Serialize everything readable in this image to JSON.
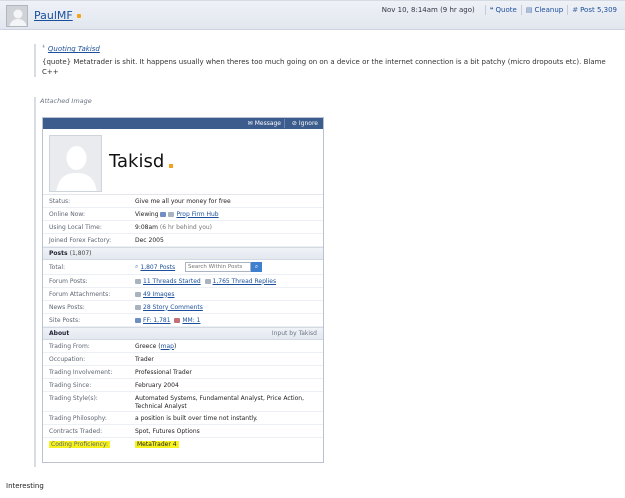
{
  "post": {
    "username": "PaulMF",
    "timestamp": "Nov 10, 8:14am (9 hr ago)",
    "actions": [
      {
        "label": "Quote",
        "icon": "quote-icon"
      },
      {
        "label": "Cleanup",
        "icon": "cleanup-icon"
      },
      {
        "label": "Post 5,309",
        "icon": "hash-icon"
      }
    ],
    "quote": {
      "author": "Quoting Takisd",
      "text": "{quote} Metatrader is shit. It happens usually when theres too much going on on a device or the internet connection is a bit patchy (micro dropouts etc). Blame C++"
    },
    "attached_label": "Attached Image",
    "reply": "Interesting"
  },
  "profile": {
    "buttons": {
      "message": "Message",
      "ignore": "Ignore"
    },
    "name": "Takisd",
    "info": [
      {
        "label": "Status:",
        "value": "Give me all your money for free"
      },
      {
        "label": "Online Now:",
        "value_prefix": "Viewing",
        "value_link": "Prop Firm Hub"
      },
      {
        "label": "Using Local Time:",
        "value": "9:08am",
        "value_muted": "(6 hr behind you)"
      },
      {
        "label": "Joined Forex Factory:",
        "value": "Dec 2005"
      }
    ],
    "posts_section": {
      "title": "Posts",
      "count": "(1,807)"
    },
    "posts": {
      "total_label": "Total:",
      "total_value": "1,807 Posts",
      "search_placeholder": "Search Within Posts",
      "forum_posts_label": "Forum Posts:",
      "threads_started": "11 Threads Started",
      "thread_replies": "1,765 Thread Replies",
      "attachments_label": "Forum Attachments:",
      "attachments_value": "49 Images",
      "news_label": "News Posts:",
      "news_value": "28 Story Comments",
      "site_label": "Site Posts:",
      "site_ff": "FF: 1,781",
      "site_mm": "MM: 1"
    },
    "about_section": {
      "title": "About",
      "right": "Input by Takisd"
    },
    "about": [
      {
        "label": "Trading From:",
        "value": "Greece",
        "value_link": "map"
      },
      {
        "label": "Occupation:",
        "value": "Trader"
      },
      {
        "label": "Trading Involvement:",
        "value": "Professional Trader"
      },
      {
        "label": "Trading Since:",
        "value": "February 2004"
      },
      {
        "label": "Trading Style(s):",
        "value": "Automated Systems, Fundamental Analyst, Price Action, Technical Analyst"
      },
      {
        "label": "Trading Philosophy:",
        "value": "a position is built over time not instantly."
      },
      {
        "label": "Contracts Traded:",
        "value": "Spot, Futures Options"
      },
      {
        "label": "Coding Proficiency:",
        "value": "MetaTrader 4"
      }
    ]
  },
  "colors": {
    "link": "#1b4f9c",
    "header_bar": "#3c5c8d",
    "highlight": "#f5f21e",
    "online_dot": "#f2a31a"
  }
}
